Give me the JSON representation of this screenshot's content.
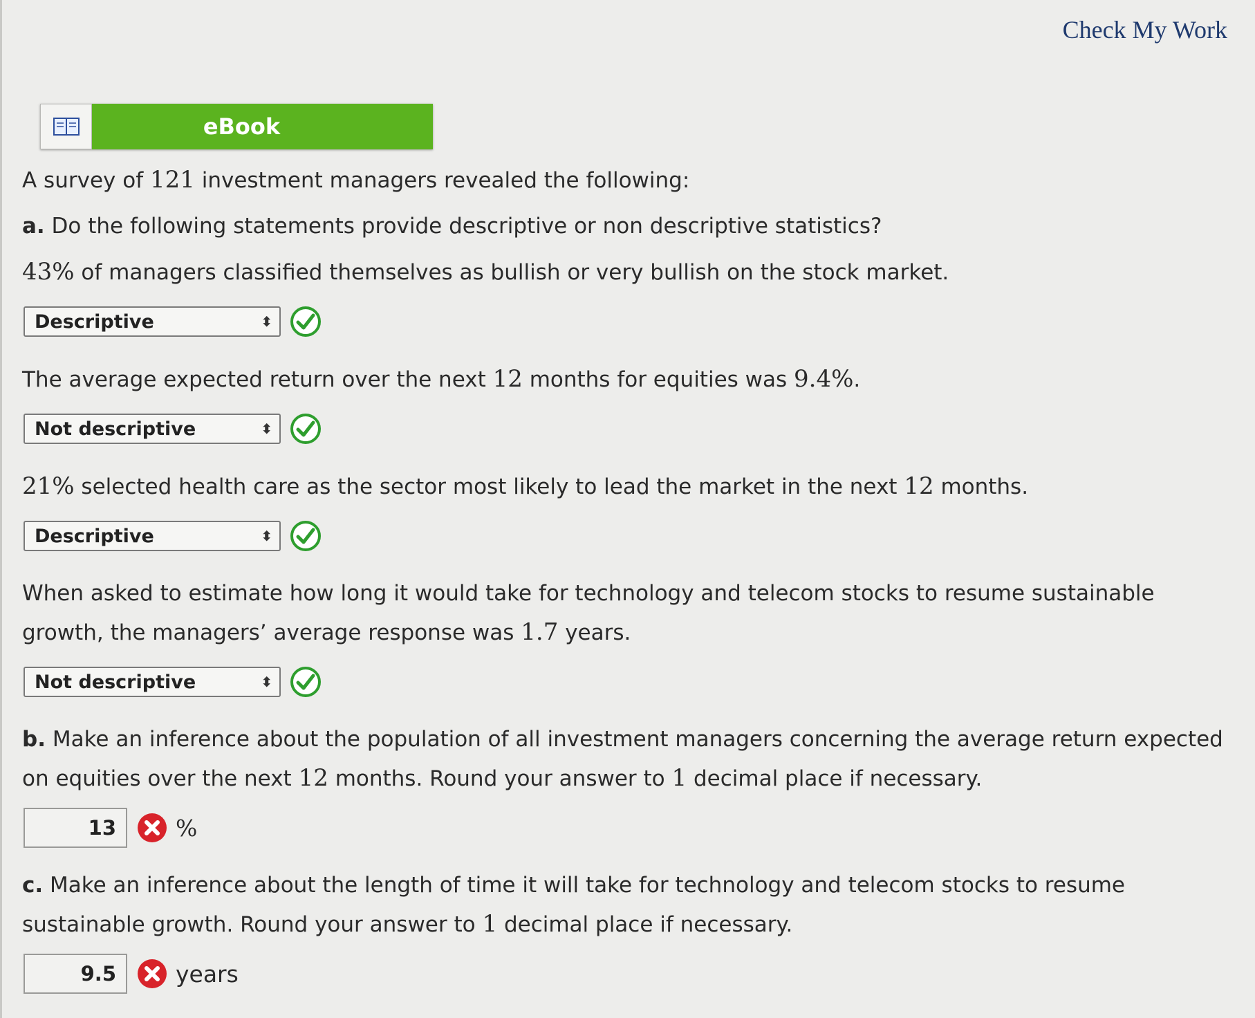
{
  "header": {
    "check_my_work": "Check My Work"
  },
  "ebook": {
    "label": "eBook"
  },
  "intro": {
    "pre": "A survey of ",
    "count": "121",
    "post": " investment managers revealed the following:"
  },
  "part_a": {
    "prefix": "a.",
    "question": " Do the following statements provide descriptive or non descriptive statistics?",
    "items": [
      {
        "text": [
          {
            "num": "43%"
          },
          {
            "t": " of managers classified themselves as bullish or very bullish on the stock market."
          }
        ],
        "answer": "Descriptive",
        "status": "correct"
      },
      {
        "text": [
          {
            "t": "The average expected return over the next "
          },
          {
            "num": "12"
          },
          {
            "t": " months for equities was "
          },
          {
            "num": "9.4%"
          },
          {
            "t": "."
          }
        ],
        "answer": "Not descriptive",
        "status": "correct"
      },
      {
        "text": [
          {
            "num": "21%"
          },
          {
            "t": " selected health care as the sector most likely to lead the market in the next "
          },
          {
            "num": "12"
          },
          {
            "t": " months."
          }
        ],
        "answer": "Descriptive",
        "status": "correct"
      },
      {
        "text": [
          {
            "t": "When asked to estimate how long it would take for technology and telecom stocks to resume sustainable growth, the managers’ average response was "
          },
          {
            "num": "1.7"
          },
          {
            "t": " years."
          }
        ],
        "answer": "Not descriptive",
        "status": "correct"
      }
    ]
  },
  "part_b": {
    "prefix": "b.",
    "question": [
      {
        "t": " Make an inference about the population of all investment managers concerning the average return expected on equities over the next "
      },
      {
        "num": "12"
      },
      {
        "t": " months. Round your answer to "
      },
      {
        "num": "1"
      },
      {
        "t": " decimal place if necessary."
      }
    ],
    "value": "13",
    "unit": "%",
    "status": "incorrect"
  },
  "part_c": {
    "prefix": "c.",
    "question": [
      {
        "t": " Make an inference about the length of time it will take for technology and telecom stocks to resume sustainable growth. Round your answer to "
      },
      {
        "num": "1"
      },
      {
        "t": " decimal place if necessary."
      }
    ],
    "value": "9.5",
    "unit": "years",
    "status": "incorrect"
  },
  "colors": {
    "correct": "#2e9e2e",
    "incorrect": "#d8232a",
    "ebook_green": "#5bb31f",
    "link": "#1f3a6e"
  }
}
